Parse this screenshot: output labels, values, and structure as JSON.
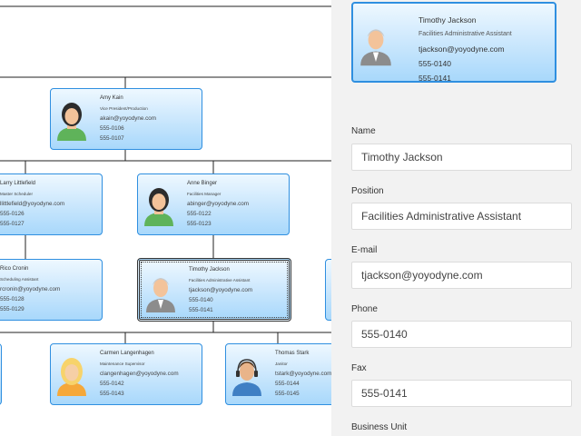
{
  "cards": [
    {
      "id": "amy-kain",
      "name": "Amy Kain",
      "title": "Vice President/Production",
      "email": "akain@yoyodyne.com",
      "phone": "555-0106",
      "fax": "555-0107",
      "avatar": "female-dark-avatar"
    },
    {
      "id": "larry-littlefield",
      "name": "Larry Littlefield",
      "title": "Master Scheduler",
      "email": "llittlefield@yoyodyne.com",
      "phone": "555-0126",
      "fax": "555-0127",
      "avatar": "male-avatar"
    },
    {
      "id": "anne-binger",
      "name": "Anne Binger",
      "title": "Facilities Manager",
      "email": "abinger@yoyodyne.com",
      "phone": "555-0122",
      "fax": "555-0123",
      "avatar": "female-dark-avatar"
    },
    {
      "id": "rico-cronin",
      "name": "Rico Cronin",
      "title": "Scheduling Assistant",
      "email": "rcronin@yoyodyne.com",
      "phone": "555-0128",
      "fax": "555-0129",
      "avatar": "male-avatar"
    },
    {
      "id": "timothy-jackson",
      "name": "Timothy Jackson",
      "title": "Facilities Administrative Assistant",
      "email": "tjackson@yoyodyne.com",
      "phone": "555-0140",
      "fax": "555-0141",
      "avatar": "male-grey-avatar"
    },
    {
      "id": "carmen-langenhagen",
      "name": "Carmen Langenhagen",
      "title": "Maintenance Supervisor",
      "email": "clangenhagen@yoyodyne.com",
      "phone": "555-0142",
      "fax": "555-0143",
      "avatar": "female-blonde-avatar"
    },
    {
      "id": "thomas-stark",
      "name": "Thomas Stark",
      "title": "Janitor",
      "email": "tstark@yoyodyne.com",
      "phone": "555-0144",
      "fax": "555-0145",
      "avatar": "male-headset-avatar"
    }
  ],
  "panel": {
    "header": {
      "name": "Timothy Jackson",
      "title": "Facilities Administrative Assistant",
      "email": "tjackson@yoyodyne.com",
      "phone": "555-0140",
      "fax": "555-0141",
      "avatar": "male-grey-avatar"
    },
    "fields": {
      "name": {
        "label": "Name",
        "value": "Timothy Jackson"
      },
      "position": {
        "label": "Position",
        "value": "Facilities Administrative Assistant"
      },
      "email": {
        "label": "E-mail",
        "value": "tjackson@yoyodyne.com"
      },
      "phone": {
        "label": "Phone",
        "value": "555-0140"
      },
      "fax": {
        "label": "Fax",
        "value": "555-0141"
      },
      "business_unit": {
        "label": "Business Unit"
      }
    }
  },
  "colors": {
    "card_border": "#2f8fe0",
    "card_fill_top": "#eef8ff",
    "card_fill_bottom": "#a8d8fb",
    "connector": "#222222",
    "panel_bg": "#f2f2f2"
  }
}
